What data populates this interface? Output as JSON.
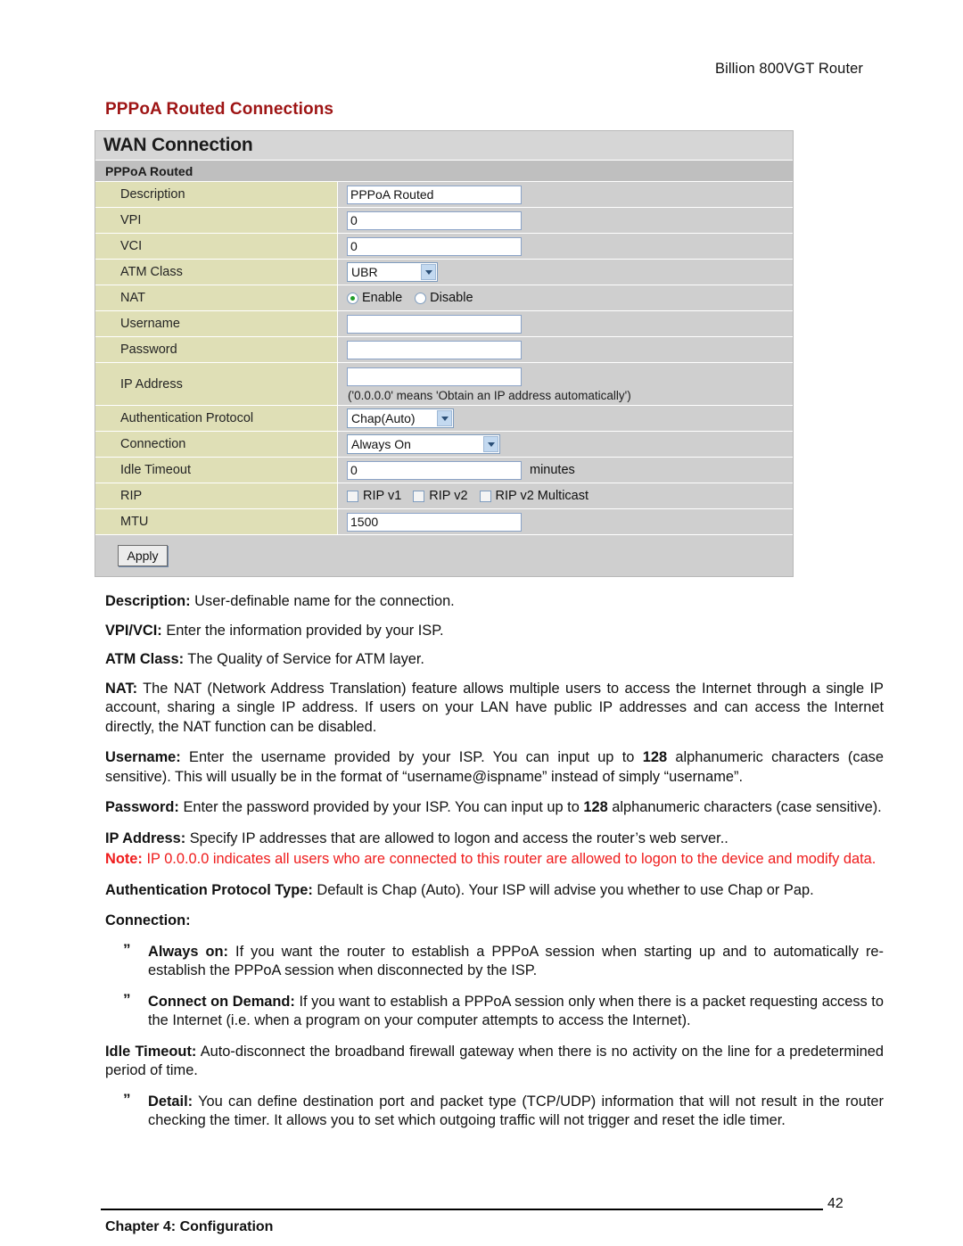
{
  "header": {
    "running_head": "Billion 800VGT Router"
  },
  "section": {
    "heading": "PPPoA Routed Connections"
  },
  "ui": {
    "title": "WAN Connection",
    "subtitle": "PPPoA Routed",
    "rows": {
      "description": {
        "label": "Description",
        "value": "PPPoA Routed"
      },
      "vpi": {
        "label": "VPI",
        "value": "0"
      },
      "vci": {
        "label": "VCI",
        "value": "0"
      },
      "atm_class": {
        "label": "ATM Class",
        "value": "UBR"
      },
      "nat": {
        "label": "NAT",
        "enable_label": "Enable",
        "disable_label": "Disable",
        "selected": "Enable"
      },
      "username": {
        "label": "Username",
        "value": ""
      },
      "password": {
        "label": "Password",
        "value": ""
      },
      "ip_address": {
        "label": "IP Address",
        "value": "",
        "hint": "('0.0.0.0' means 'Obtain an IP address automatically')"
      },
      "auth_protocol": {
        "label": "Authentication Protocol",
        "value": "Chap(Auto)"
      },
      "connection": {
        "label": "Connection",
        "value": "Always On"
      },
      "idle_timeout": {
        "label": "Idle Timeout",
        "value": "0",
        "unit": "minutes"
      },
      "rip": {
        "label": "RIP",
        "options": [
          {
            "label": "RIP v1",
            "checked": false
          },
          {
            "label": "RIP v2",
            "checked": false
          },
          {
            "label": "RIP v2 Multicast",
            "checked": false
          }
        ]
      },
      "mtu": {
        "label": "MTU",
        "value": "1500"
      }
    },
    "apply_label": "Apply"
  },
  "body": {
    "description_term": "Description:",
    "description_text": " User-definable name for the connection.",
    "vpivci_term": "VPI/VCI:",
    "vpivci_text": " Enter the information provided by your ISP.",
    "atmclass_term": "ATM Class:",
    "atmclass_text": " The Quality of Service for ATM layer.",
    "nat_term": "NAT:",
    "nat_text": " The NAT (Network Address Translation) feature allows multiple users to access the Internet through a single IP account, sharing a single IP address. If users on your LAN have public IP addresses and can access the Internet directly, the NAT function can be disabled.",
    "username_term": "Username:",
    "username_text_1": " Enter the username provided by your ISP. You can input up to ",
    "username_bold_128": "128",
    "username_text_2": " alphanumeric characters (case sensitive). This will usually be in the format of “username@ispname” instead of simply “username”.",
    "password_term": "Password:",
    "password_text_1": " Enter the password provided by your ISP. You can input up to ",
    "password_bold_128": "128",
    "password_text_2": " alphanumeric characters (case sensitive).",
    "ipaddress_term": "IP Address:",
    "ipaddress_text": " Specify IP addresses that are allowed to logon and access the router’s web server..",
    "note_term": "Note:",
    "note_text": " IP 0.0.0.0 indicates all users who are connected to this router are allowed to logon to the device and modify data.",
    "auth_term": "Authentication Protocol Type:",
    "auth_text": " Default is Chap (Auto). Your ISP will advise you whether to use Chap or Pap.",
    "connection_heading": "Connection:",
    "bullet_marker": "”",
    "always_on_term": "Always on:",
    "always_on_text": " If you want the router to establish a PPPoA session when starting up and to automatically re-establish the PPPoA session when disconnected by the ISP.",
    "connect_demand_term": "Connect on Demand:",
    "connect_demand_text": " If you want to establish a PPPoA session only when there is a packet requesting access to the Internet (i.e. when a program on your computer attempts to access the Internet).",
    "idle_timeout_term": "Idle Timeout:",
    "idle_timeout_text": " Auto-disconnect the broadband firewall gateway when there is no activity on the line for a predetermined period of time.",
    "detail_term": "Detail:",
    "detail_text": " You can define destination port and packet type (TCP/UDP) information that will not result in the router checking the timer. It allows you to set which outgoing traffic will not trigger and reset the idle timer."
  },
  "footer": {
    "chapter": "Chapter 4: Configuration",
    "page_number": "42"
  },
  "colors": {
    "heading_red": "#9e1414",
    "note_red": "#ef1c1c",
    "label_cell": "#dfdfb6",
    "panel_bg": "#cfcfcf"
  }
}
